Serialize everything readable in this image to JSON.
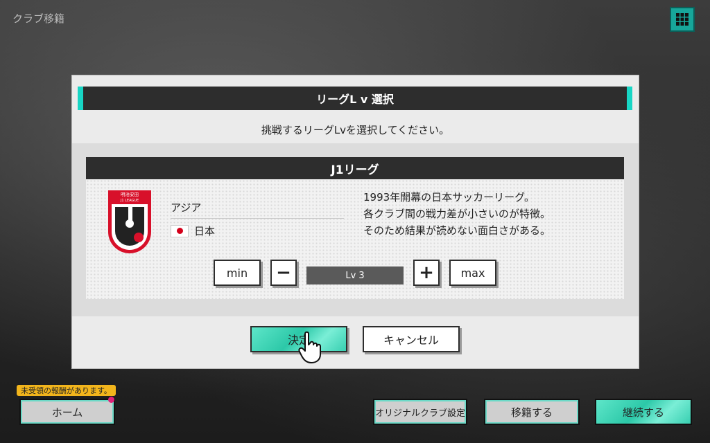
{
  "screen": {
    "title": "クラブ移籍"
  },
  "dialog": {
    "title": "リーグL v 選択",
    "subtitle": "挑戦するリーグLvを選択してください。",
    "league": {
      "name": "J1リーグ",
      "emblem_text_top": "明治安田",
      "emblem_text_bottom": "J1 LEAGUE",
      "region": "アジア",
      "country": "日本",
      "description": [
        "1993年開幕の日本サッカーリーグ。",
        "各クラブ間の戦力差が小さいのが特徴。",
        "そのため結果が読めない面白さがある。"
      ]
    },
    "level": {
      "min_label": "min",
      "minus_label": "−",
      "display": "Lv 3",
      "plus_label": "+",
      "max_label": "max"
    },
    "confirm_label": "決定",
    "cancel_label": "キャンセル"
  },
  "bottom": {
    "notice": "未受領の報酬があります。",
    "home_label": "ホーム",
    "original_club_label": "オリジナルクラブ設定",
    "transfer_label": "移籍する",
    "continue_label": "継続する"
  },
  "colors": {
    "accent": "#18d6c5",
    "dark": "#2d2d2d",
    "notice": "#f2b51c",
    "badge": "#e0227a"
  }
}
